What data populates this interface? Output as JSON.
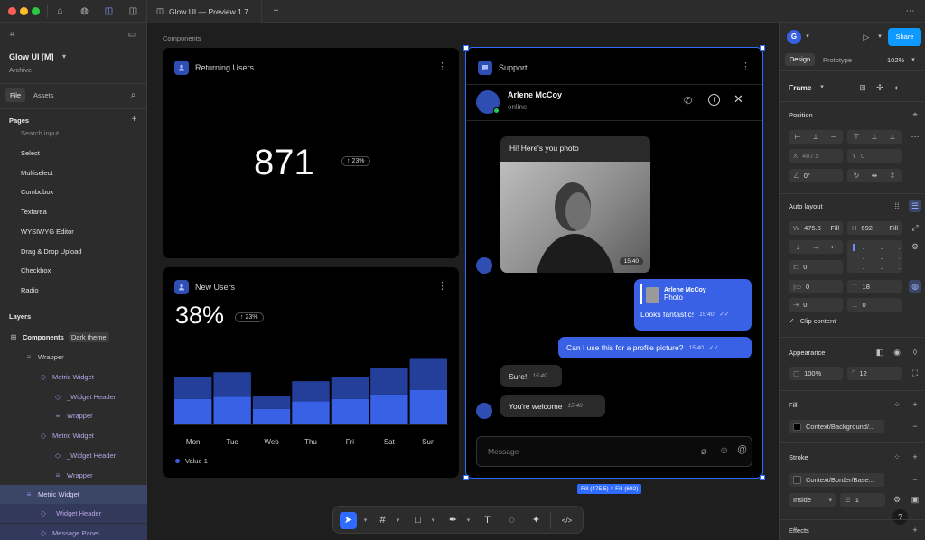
{
  "window": {
    "tab_title": "Glow UI — Preview 1.7"
  },
  "file": {
    "name": "Glow UI [M]",
    "subtitle": "Archive",
    "tab_file": "File",
    "tab_assets": "Assets"
  },
  "pages": {
    "title": "Pages",
    "items": [
      "Search input",
      "Select",
      "Multiselect",
      "Combobox",
      "Textarea",
      "WYSIWYG Editor",
      "Drag & Drop Upload",
      "Checkbox",
      "Radio"
    ]
  },
  "layers": {
    "title": "Layers",
    "items": [
      {
        "label": "Components",
        "badge": "Dark theme",
        "icon": "frame-icon"
      },
      {
        "label": "Wrapper",
        "icon": "autolayout-icon"
      },
      {
        "label": "Metric Widget",
        "icon": "component-icon"
      },
      {
        "label": "_Widget Header",
        "icon": "component-icon"
      },
      {
        "label": "Wrapper",
        "icon": "autolayout-icon"
      },
      {
        "label": "Metric Widget",
        "icon": "component-icon"
      },
      {
        "label": "_Widget Header",
        "icon": "component-icon"
      },
      {
        "label": "Wrapper",
        "icon": "autolayout-icon"
      },
      {
        "label": "Metric Widget",
        "icon": "autolayout-icon"
      },
      {
        "label": "_Widget Header",
        "icon": "component-icon"
      },
      {
        "label": "Message Panel",
        "icon": "component-icon"
      }
    ]
  },
  "canvas": {
    "section_label": "Components",
    "returning": {
      "title": "Returning Users",
      "value": "871",
      "change": "23%"
    },
    "new_users": {
      "title": "New Users",
      "value": "38%",
      "change": "23%",
      "legend": "Value 1"
    },
    "support": {
      "title": "Support",
      "contact_name": "Arlene McCoy",
      "contact_status": "online",
      "photo_caption": "Hi! Here's you photo",
      "photo_time": "15:40",
      "reply_name": "Arlene McCoy",
      "reply_label": "Photo",
      "msg1": "Looks fantastic!",
      "msg1_time": "15:40",
      "msg2": "Can I use this for a profile picture?",
      "msg2_time": "15:40",
      "msg3": "Sure!",
      "msg3_time": "15:40",
      "msg4": "You're welcome",
      "msg4_time": "15:40",
      "input_placeholder": "Message"
    },
    "selection_label": "Fill (475.5) × Fill (692)"
  },
  "chart_data": {
    "type": "bar",
    "categories": [
      "Mon",
      "Tue",
      "Web",
      "Thu",
      "Fri",
      "Sat",
      "Sun"
    ],
    "series": [
      {
        "values": [
          22,
          24,
          13,
          20,
          22,
          26,
          30
        ],
        "color": "#3861e6"
      },
      {
        "values": [
          20,
          22,
          12,
          18,
          20,
          24,
          28
        ],
        "color": "#233f99"
      }
    ],
    "ylim": [
      0,
      60
    ],
    "legend": [
      "Value 1"
    ]
  },
  "right_panel": {
    "share": "Share",
    "tab_design": "Design",
    "tab_prototype": "Prototype",
    "zoom": "102%",
    "frame_label": "Frame",
    "position": {
      "title": "Position",
      "x_key": "X",
      "x": "487.5",
      "y_key": "Y",
      "y": "0",
      "rotation": "0°"
    },
    "auto_layout": {
      "title": "Auto layout",
      "w_key": "W",
      "w": "475.5",
      "w_mode": "Fill",
      "h_key": "H",
      "h": "692",
      "h_mode": "Fill",
      "gap": "0",
      "pad_h": "0",
      "pad_v": "18",
      "pad_l": "0",
      "pad_b": "0",
      "clip": "Clip content"
    },
    "appearance": {
      "title": "Appearance",
      "opacity": "100%",
      "radius": "12"
    },
    "fill": {
      "title": "Fill",
      "value": "Context/Background/..."
    },
    "stroke": {
      "title": "Stroke",
      "value": "Context/Border/Base...",
      "position": "Inside",
      "weight": "1"
    },
    "effects": {
      "title": "Effects"
    }
  }
}
